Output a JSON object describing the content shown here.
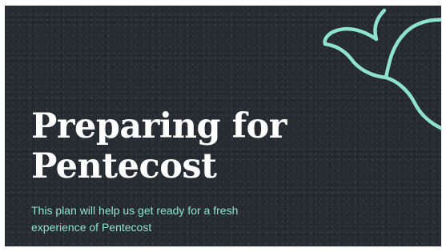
{
  "slide": {
    "title_line1": "Preparing for",
    "title_line2": "Pentecost",
    "subtitle_line1": "This plan will help us get ready for a fresh",
    "subtitle_line2": "experience of Pentecost"
  },
  "colors": {
    "background": "#262b31",
    "title": "#ffffff",
    "accent": "#8ee3d0"
  },
  "icons": {
    "dove": "dove-icon"
  }
}
